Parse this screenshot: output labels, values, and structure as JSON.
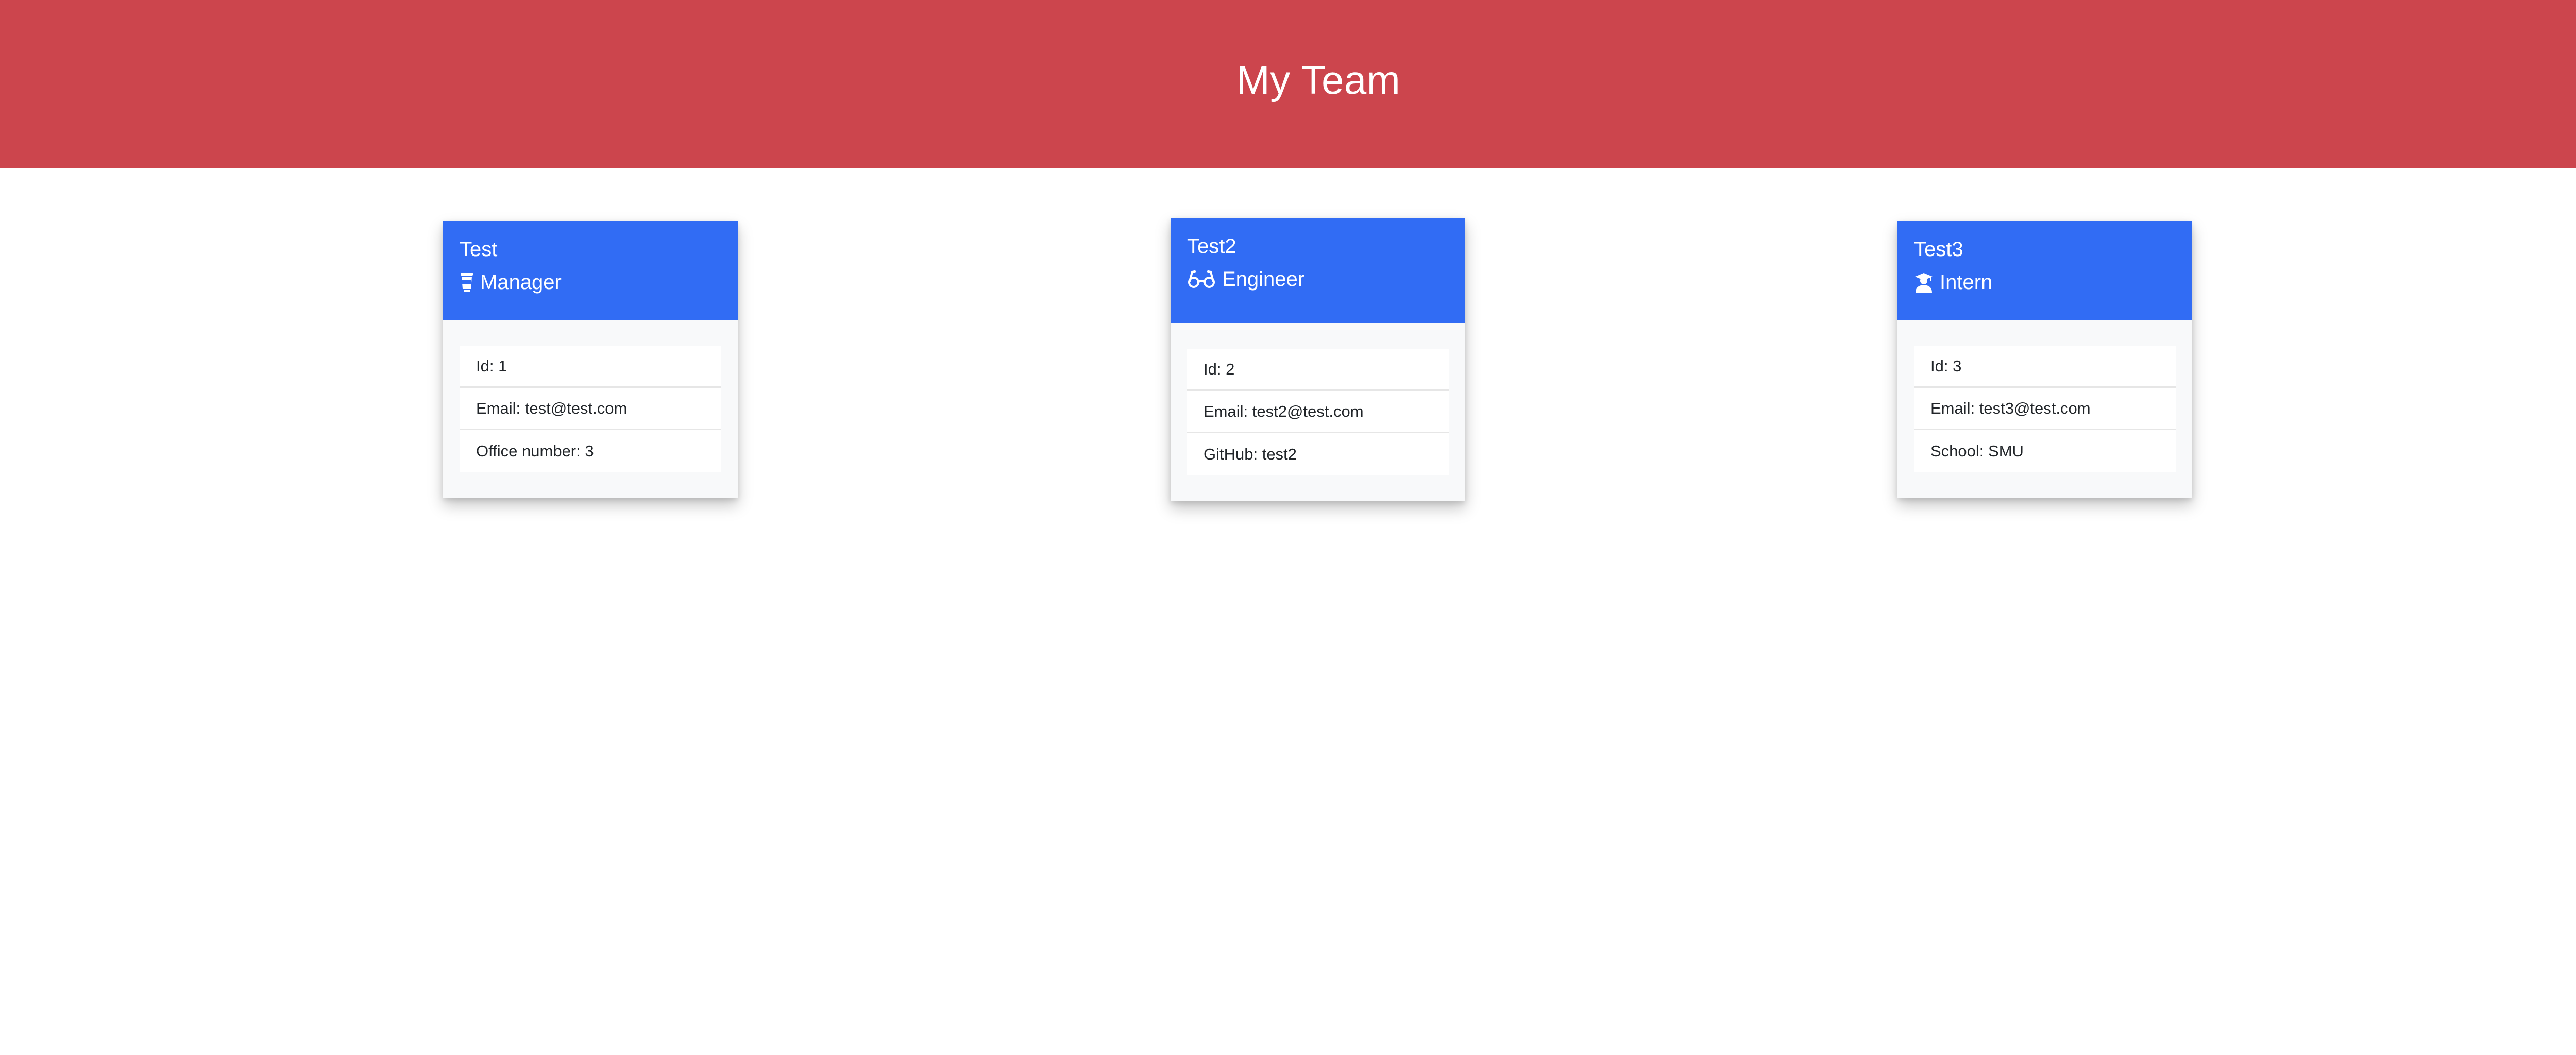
{
  "header": {
    "title": "My Team",
    "background": "#cc454d"
  },
  "theme": {
    "card_header_color": "#316cf4",
    "card_body_color": "#f8f9fa"
  },
  "team": [
    {
      "name": "Test",
      "role": "Manager",
      "role_icon": "coffee-cup-icon",
      "details": [
        "Id: 1",
        "Email: test@test.com",
        "Office number: 3"
      ]
    },
    {
      "name": "Test2",
      "role": "Engineer",
      "role_icon": "glasses-icon",
      "details": [
        "Id: 2",
        "Email: test2@test.com",
        "GitHub: test2"
      ]
    },
    {
      "name": "Test3",
      "role": "Intern",
      "role_icon": "graduate-icon",
      "details": [
        "Id: 3",
        "Email: test3@test.com",
        "School: SMU"
      ]
    }
  ]
}
